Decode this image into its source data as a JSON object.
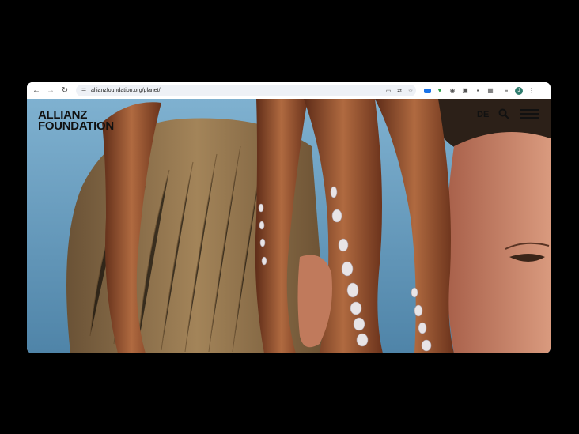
{
  "browser": {
    "url": "allianzfoundation.org/planet/",
    "profile_initial": "J",
    "icons": {
      "back": "arrow-left-icon",
      "forward": "arrow-right-icon",
      "reload": "reload-icon",
      "site_info": "tune-icon",
      "cast": "cast-icon",
      "translate": "translate-icon",
      "bookmark": "star-icon",
      "extensions": "puzzle-icon",
      "menu": "kebab-menu-icon"
    }
  },
  "site": {
    "logo_line1": "ALLIANZ",
    "logo_line2": "FOUNDATION",
    "language": "DE",
    "hero_alt": "Photograph of a person's hair with octopus tentacles draped over the head, face in profile at the right, blue water in the background"
  },
  "colors": {
    "water": "#5c8fb0",
    "tentacle": "#8a4a28",
    "sucker": "#e8e4e6",
    "hair": "#8a6a44",
    "skin": "#c98468",
    "text": "#111111"
  }
}
